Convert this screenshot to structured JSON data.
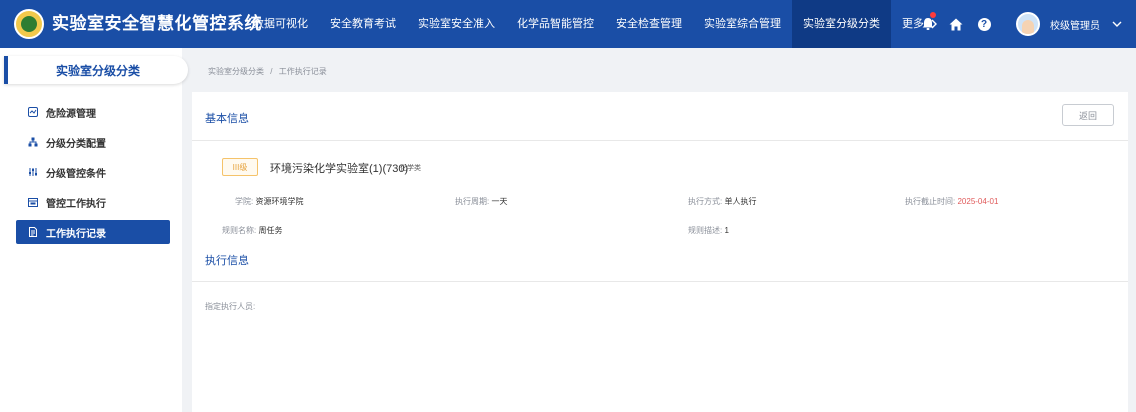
{
  "header": {
    "system_title": "实验室安全智慧化管控系统",
    "nav": [
      {
        "label": "数据可视化",
        "active": false
      },
      {
        "label": "安全教育考试",
        "active": false
      },
      {
        "label": "实验室安全准入",
        "active": false
      },
      {
        "label": "化学品智能管控",
        "active": false
      },
      {
        "label": "安全检查管理",
        "active": false
      },
      {
        "label": "实验室综合管理",
        "active": false
      },
      {
        "label": "实验室分级分类",
        "active": true
      }
    ],
    "more_label": "更多",
    "user_name": "校级管理员"
  },
  "sidebar": {
    "title": "实验室分级分类",
    "items": [
      {
        "label": "危险源管理",
        "icon": "hazard-icon",
        "active": false
      },
      {
        "label": "分级分类配置",
        "icon": "hierarchy-icon",
        "active": false
      },
      {
        "label": "分级管控条件",
        "icon": "sliders-icon",
        "active": false
      },
      {
        "label": "管控工作执行",
        "icon": "calendar-icon",
        "active": false
      },
      {
        "label": "工作执行记录",
        "icon": "record-icon",
        "active": true
      }
    ]
  },
  "breadcrumb": {
    "parent": "实验室分级分类",
    "separator": "/",
    "current": "工作执行记录"
  },
  "basic_info": {
    "title": "基本信息",
    "back_label": "返回",
    "level_tag": "III级",
    "lab_name": "环境污染化学实验室(1)(730)",
    "lab_type": "化学类",
    "college_label": "学院:",
    "college": "资源环境学院",
    "cycle_label": "执行周期:",
    "cycle": "一天",
    "mode_label": "执行方式:",
    "mode": "单人执行",
    "deadline_label": "执行截止时间:",
    "deadline": "2025-04-01",
    "rule_name_label": "规则名称:",
    "rule_name": "周任务",
    "rule_desc_label": "规则描述:",
    "rule_desc": "1"
  },
  "exec_info": {
    "title": "执行信息",
    "assignee_label": "指定执行人员:"
  },
  "colors": {
    "primary": "#1a4ea6",
    "nav_active": "#0f3a85",
    "deadline": "#e05a5a",
    "tag": "#e6a23c"
  }
}
